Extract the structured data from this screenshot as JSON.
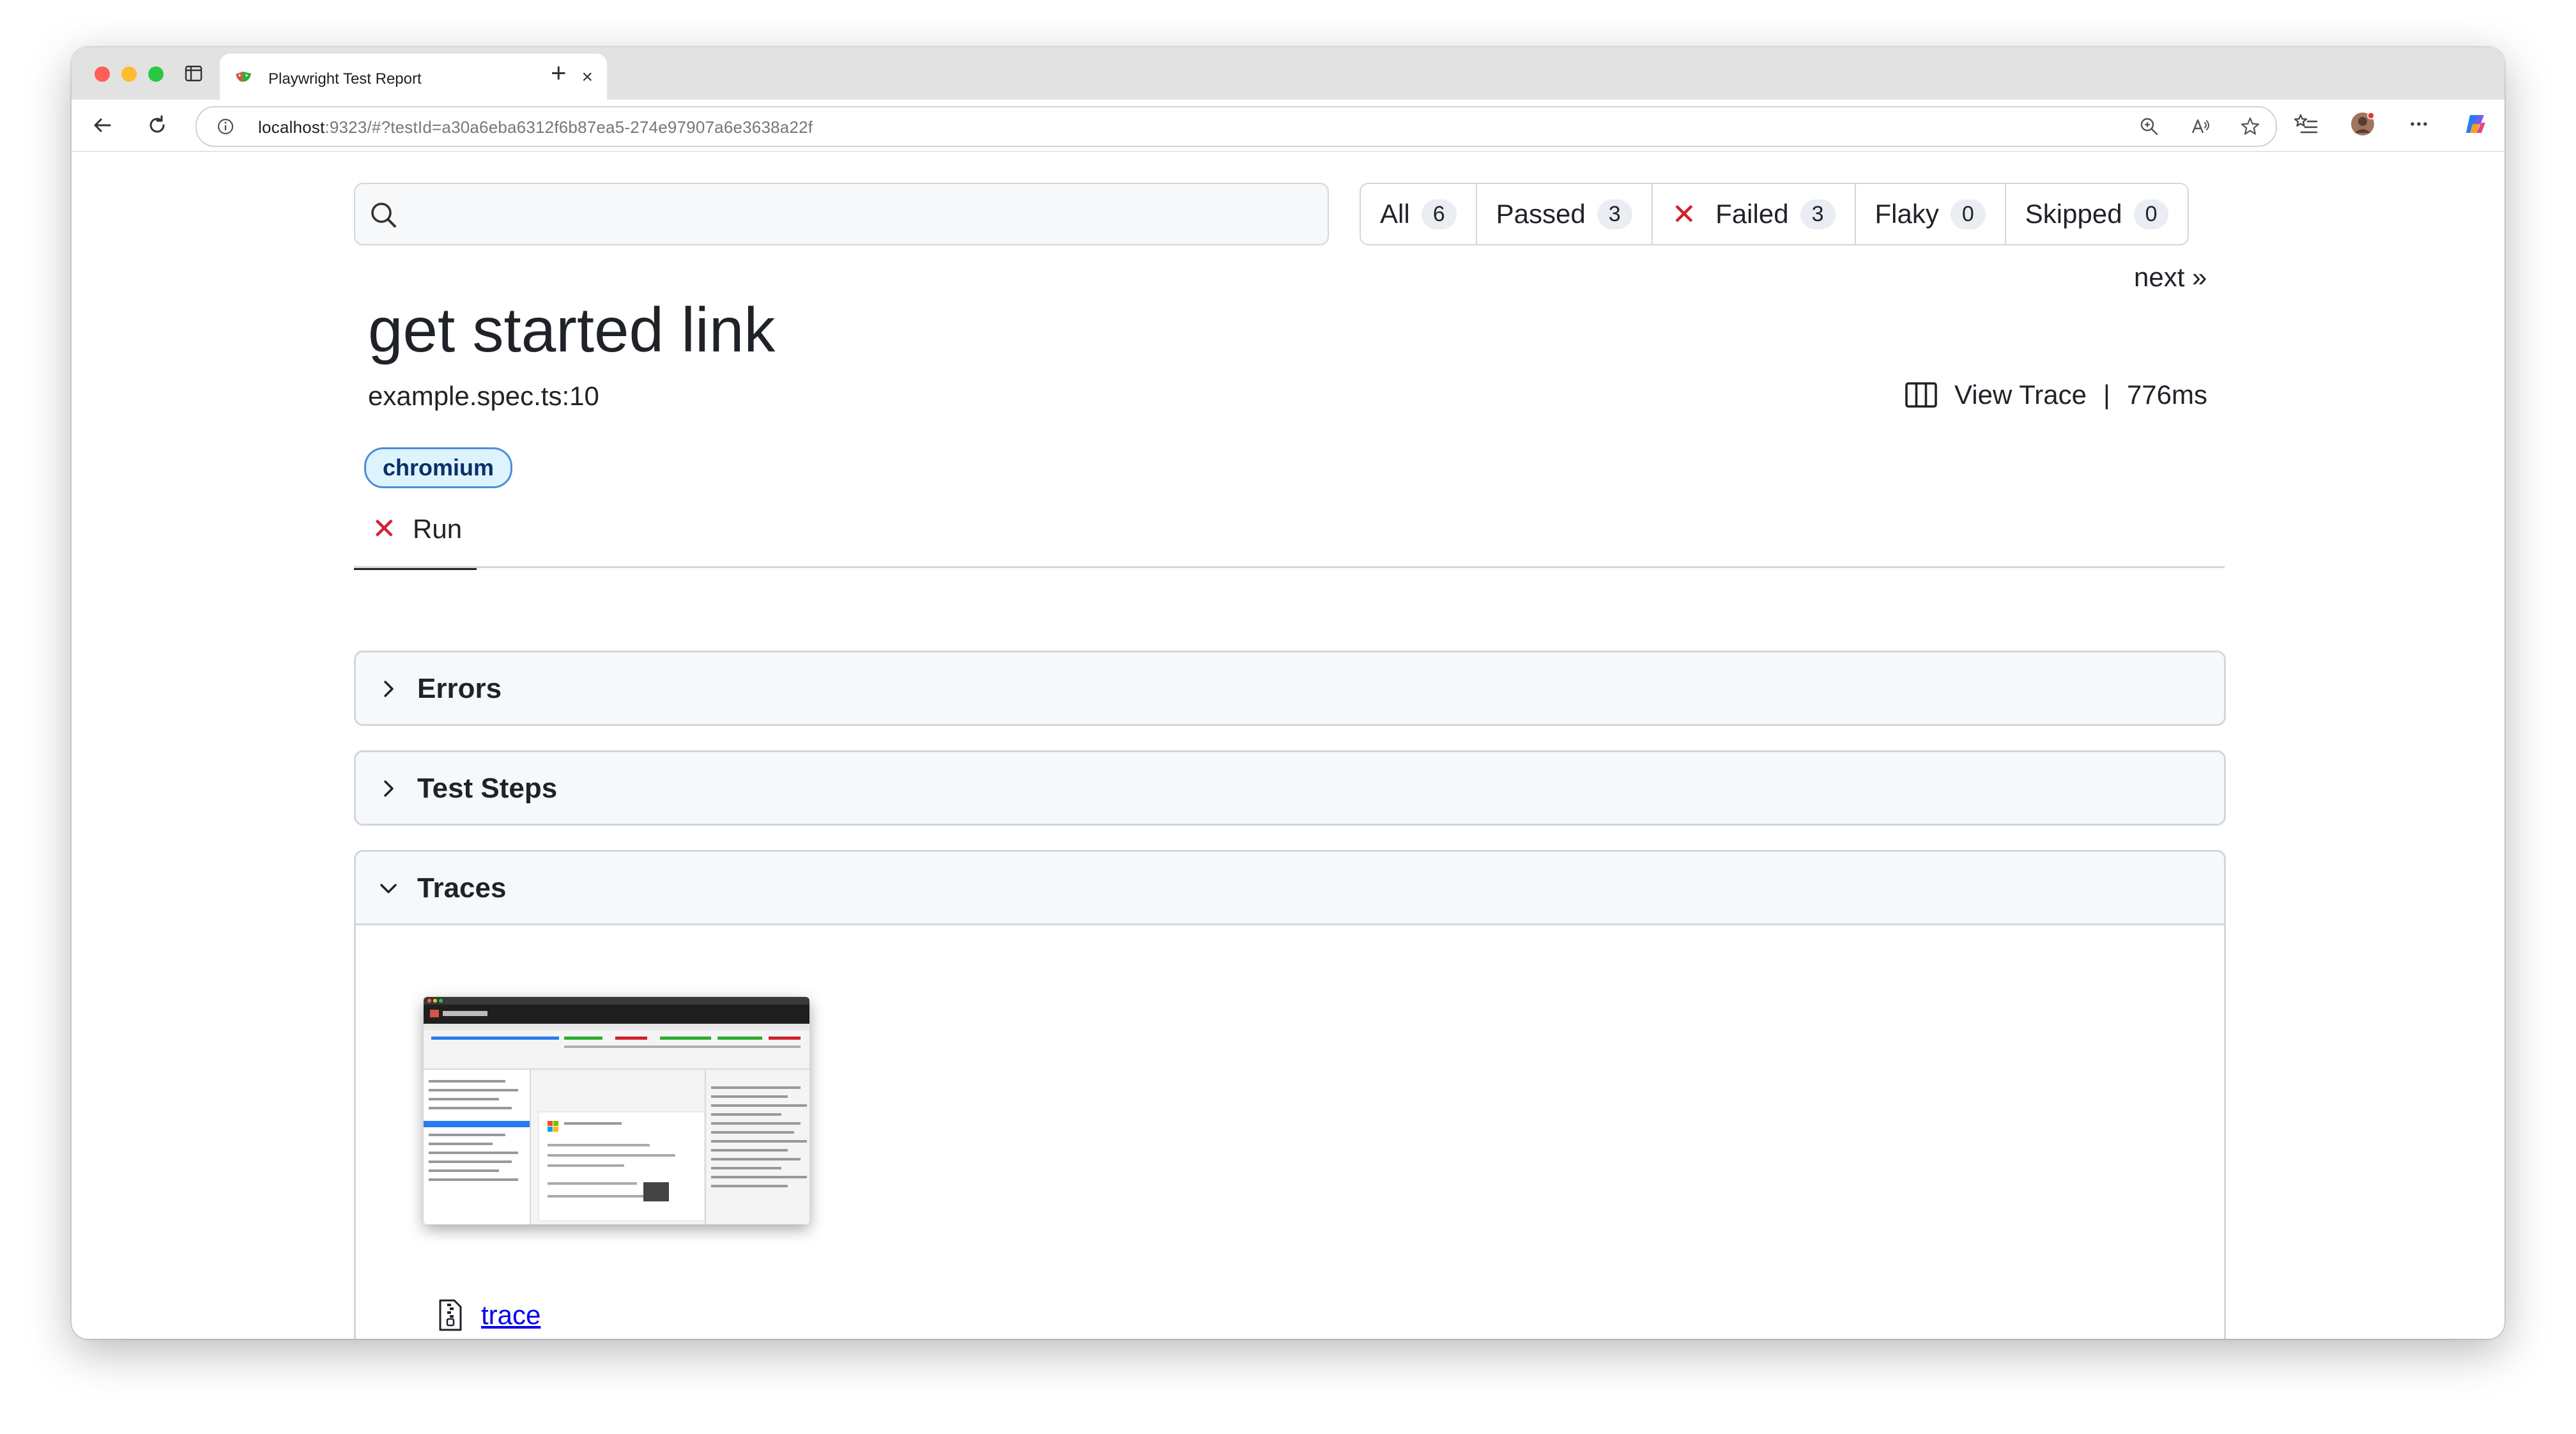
{
  "browser": {
    "tab_title": "Playwright Test Report",
    "tab_close_glyph": "×",
    "new_tab_glyph": "+",
    "url_host": "localhost",
    "url_rest": ":9323/#?testId=a30a6eba6312f6b87ea5-274e97907a6e3638a22f",
    "icons": [
      "back-icon",
      "reload-icon",
      "info-icon",
      "zoom-icon",
      "read-aloud-icon",
      "favorite-star-icon",
      "favorites-list-icon",
      "profile-avatar",
      "more-icon",
      "copilot-icon"
    ]
  },
  "filters": [
    {
      "label": "All",
      "count": "6"
    },
    {
      "label": "Passed",
      "count": "3"
    },
    {
      "label": "Failed",
      "count": "3",
      "icon": "x-icon"
    },
    {
      "label": "Flaky",
      "count": "0"
    },
    {
      "label": "Skipped",
      "count": "0"
    }
  ],
  "failed_glyph": "✕",
  "next_label": "next »",
  "test": {
    "title": "get started link",
    "location": "example.spec.ts:10",
    "view_trace_label": "View Trace",
    "separator": "|",
    "duration": "776ms",
    "project": "chromium"
  },
  "result_tab": {
    "label": "Run",
    "status": "failed"
  },
  "sections": [
    {
      "title": "Errors",
      "expanded": false
    },
    {
      "title": "Test Steps",
      "expanded": false
    },
    {
      "title": "Traces",
      "expanded": true
    }
  ],
  "trace_file": {
    "name": "trace"
  },
  "colors": {
    "failed": "#cf222e",
    "border": "#d0d7de",
    "header_bg": "#f6f8fa",
    "label_bg": "#ddf4ff",
    "label_border": "#4a8fd4",
    "link": "#0000ee"
  }
}
